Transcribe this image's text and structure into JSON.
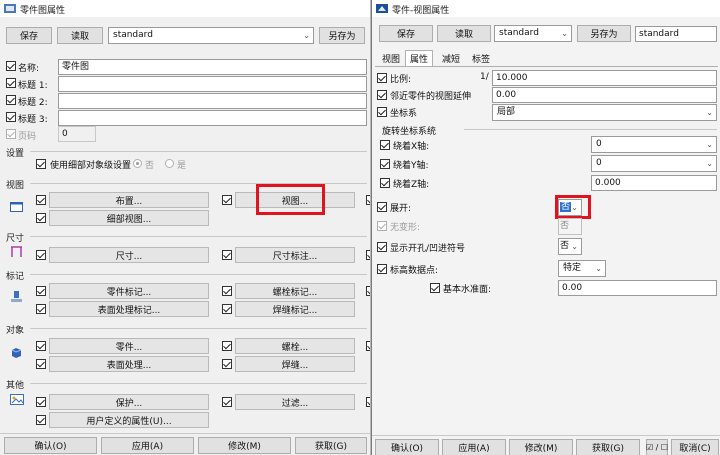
{
  "left": {
    "title": "零件图属性",
    "toolbar": {
      "save": "保存",
      "load": "读取",
      "preset": "standard",
      "save_as": "另存为"
    },
    "fields": [
      {
        "label": "名称:",
        "value": "零件图"
      },
      {
        "label": "标题 1:",
        "value": ""
      },
      {
        "label": "标题 2:",
        "value": ""
      },
      {
        "label": "标题 3:",
        "value": ""
      },
      {
        "label": "页码",
        "value": "0"
      }
    ],
    "settings": {
      "section": "设置",
      "use_detail": "使用细部对象级设置",
      "radio_no": "否",
      "radio_yes": "是"
    },
    "sections": {
      "view": "视图",
      "dim": "尺寸",
      "mark": "标记",
      "obj": "对象",
      "other": "其他"
    },
    "buttons": {
      "layout": "布置...",
      "view": "视图...",
      "detail_view": "细部视图...",
      "dimension": "尺寸...",
      "dim_mark": "尺寸标注...",
      "part_mark": "零件标记...",
      "bolt_mark": "螺栓标记...",
      "surface_mark": "表面处理标记...",
      "weld_mark": "焊缝标记...",
      "part": "零件...",
      "bolt": "螺栓...",
      "surface": "表面处理...",
      "weld": "焊缝...",
      "protect": "保护...",
      "filter": "过滤...",
      "user_attr": "用户定义的属性(U)..."
    },
    "footer": {
      "ok": "确认(O)",
      "apply": "应用(A)",
      "modify": "修改(M)",
      "get": "获取(G)"
    }
  },
  "right": {
    "title": "零件-视图属性",
    "toolbar": {
      "save": "保存",
      "load": "读取",
      "preset": "standard",
      "save_as": "另存为",
      "name_value": "standard"
    },
    "tabs": [
      "视图",
      "属性",
      "减短",
      "标签"
    ],
    "scale": {
      "label": "比例:",
      "prefix": "1/",
      "value": "10.000"
    },
    "extend": {
      "label": "邻近零件的视图延伸",
      "value": "0.00"
    },
    "coord": {
      "label": "坐标系",
      "value": "局部"
    },
    "rotate_section": "旋转坐标系统",
    "rot_x": {
      "label": "绕着X轴:",
      "value": "0"
    },
    "rot_y": {
      "label": "绕着Y轴:",
      "value": "0"
    },
    "rot_z": {
      "label": "绕着Z轴:",
      "value": "0.000"
    },
    "unfold": {
      "label": "展开:",
      "value": "否"
    },
    "no_deform": {
      "label": "无变形:",
      "value": "否"
    },
    "show_hole": {
      "label": "显示开孔/凹进符号",
      "value": "否"
    },
    "elev_point": {
      "label": "标高数据点:",
      "value": "特定"
    },
    "base_level": {
      "label": "基本水准面:",
      "value": "0.00"
    },
    "footer": {
      "ok": "确认(O)",
      "apply": "应用(A)",
      "modify": "修改(M)",
      "get": "获取(G)",
      "toggle": "☑ / ☐",
      "cancel": "取消(C)"
    }
  }
}
